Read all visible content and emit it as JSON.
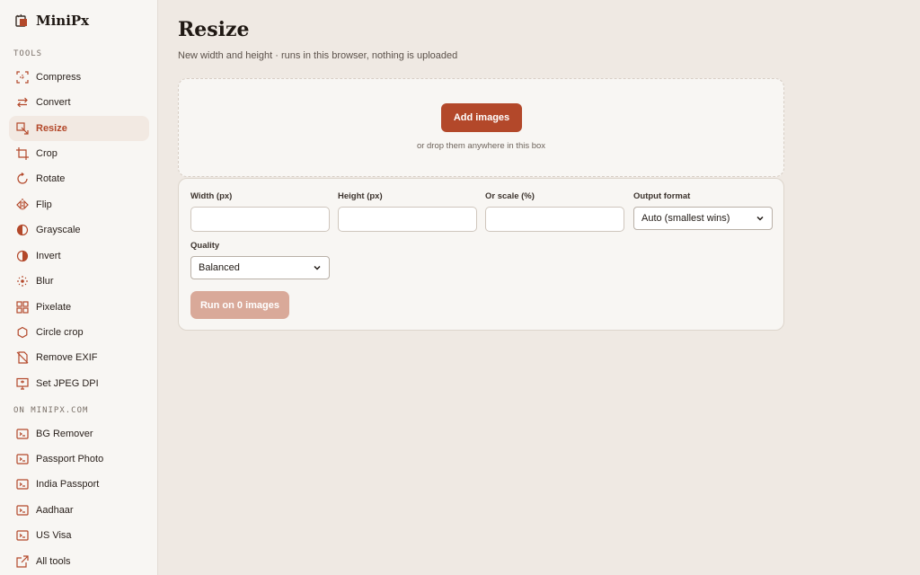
{
  "brand": {
    "name": "MiniPx"
  },
  "sidebar": {
    "tools_label": "TOOLS",
    "tools": [
      {
        "label": "Compress",
        "icon": "compress-icon"
      },
      {
        "label": "Convert",
        "icon": "convert-icon"
      },
      {
        "label": "Resize",
        "icon": "resize-icon",
        "active": true
      },
      {
        "label": "Crop",
        "icon": "crop-icon"
      },
      {
        "label": "Rotate",
        "icon": "rotate-icon"
      },
      {
        "label": "Flip",
        "icon": "flip-icon"
      },
      {
        "label": "Grayscale",
        "icon": "grayscale-icon"
      },
      {
        "label": "Invert",
        "icon": "invert-icon"
      },
      {
        "label": "Blur",
        "icon": "blur-icon"
      },
      {
        "label": "Pixelate",
        "icon": "pixelate-icon"
      },
      {
        "label": "Circle crop",
        "icon": "circle-crop-icon"
      },
      {
        "label": "Remove EXIF",
        "icon": "remove-exif-icon"
      },
      {
        "label": "Set JPEG DPI",
        "icon": "dpi-icon"
      }
    ],
    "external_label": "ON MINIPX.COM",
    "external": [
      {
        "label": "BG Remover",
        "icon": "terminal-icon"
      },
      {
        "label": "Passport Photo",
        "icon": "terminal-icon"
      },
      {
        "label": "India Passport",
        "icon": "terminal-icon"
      },
      {
        "label": "Aadhaar",
        "icon": "terminal-icon"
      },
      {
        "label": "US Visa",
        "icon": "terminal-icon"
      },
      {
        "label": "All tools",
        "icon": "external-link-icon"
      }
    ]
  },
  "main": {
    "title": "Resize",
    "subtitle": "New width and height · runs in this browser, nothing is uploaded",
    "dropzone": {
      "button_label": "Add images",
      "hint": "or drop them anywhere in this box"
    },
    "form": {
      "width_label": "Width (px)",
      "width_value": "",
      "height_label": "Height (px)",
      "height_value": "",
      "scale_label": "Or scale (%)",
      "scale_value": "",
      "format_label": "Output format",
      "format_value": "Auto (smallest wins)",
      "quality_label": "Quality",
      "quality_value": "Balanced",
      "run_label": "Run on 0 images"
    }
  },
  "colors": {
    "accent": "#b3482a",
    "accent_disabled": "#d9a999",
    "background": "#efe9e3",
    "panel": "#f8f6f3"
  }
}
